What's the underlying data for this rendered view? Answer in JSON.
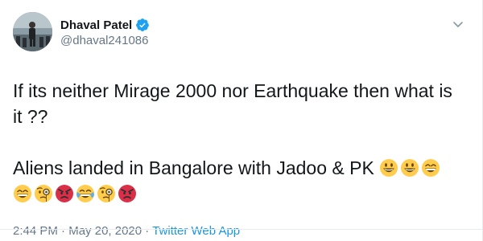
{
  "user": {
    "display_name": "Dhaval Patel",
    "handle": "@dhaval241086",
    "verified": true
  },
  "tweet": {
    "line1": "If its neither Mirage 2000 nor Earthquake then what is it ??",
    "line2_text": "Aliens landed in Bangalore with Jadoo & PK ",
    "emojis": [
      "grinning-face",
      "grinning-face",
      "grinning-smiling-eyes",
      "grinning-smiling-eyes",
      "face-with-monocle",
      "angry-face",
      "face-with-tears-of-joy",
      "face-with-monocle",
      "angry-face"
    ]
  },
  "meta": {
    "time": "2:44 PM",
    "separator1": " · ",
    "date": "May 20, 2020",
    "separator2": " · ",
    "source": "Twitter Web App"
  },
  "colors": {
    "verified": "#1da1f2",
    "link": "#1b95e0",
    "secondary_text": "#657786",
    "emoji_yellow": "#ffcc4d",
    "emoji_red": "#da2f47"
  },
  "icons": {
    "verified": "verified-badge-icon",
    "menu": "chevron-down-icon"
  }
}
